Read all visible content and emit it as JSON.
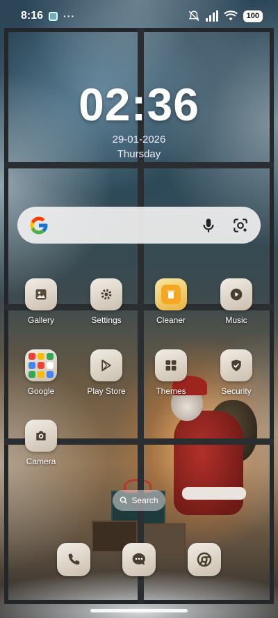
{
  "status_bar": {
    "time": "8:16",
    "more": "···",
    "battery": "100"
  },
  "clock": {
    "time": "02:36",
    "date": "29-01-2026",
    "weekday": "Thursday"
  },
  "apps": [
    {
      "label": "Gallery",
      "icon": "gallery-icon"
    },
    {
      "label": "Settings",
      "icon": "gear-icon"
    },
    {
      "label": "Cleaner",
      "icon": "trash-icon"
    },
    {
      "label": "Music",
      "icon": "play-icon"
    },
    {
      "label": "Google",
      "icon": "folder-icon"
    },
    {
      "label": "Play Store",
      "icon": "play-store-icon"
    },
    {
      "label": "Themes",
      "icon": "themes-icon"
    },
    {
      "label": "Security",
      "icon": "shield-icon"
    },
    {
      "label": "Camera",
      "icon": "camera-icon"
    }
  ],
  "search_pill": {
    "label": "Search"
  },
  "dock": [
    {
      "icon": "phone-icon"
    },
    {
      "icon": "messages-icon"
    },
    {
      "icon": "chrome-icon"
    }
  ],
  "colors": {
    "cleaner_accent": "#f5a623",
    "search_bar": "#f0f0f0",
    "icon_tile": "#e6ddd0"
  }
}
